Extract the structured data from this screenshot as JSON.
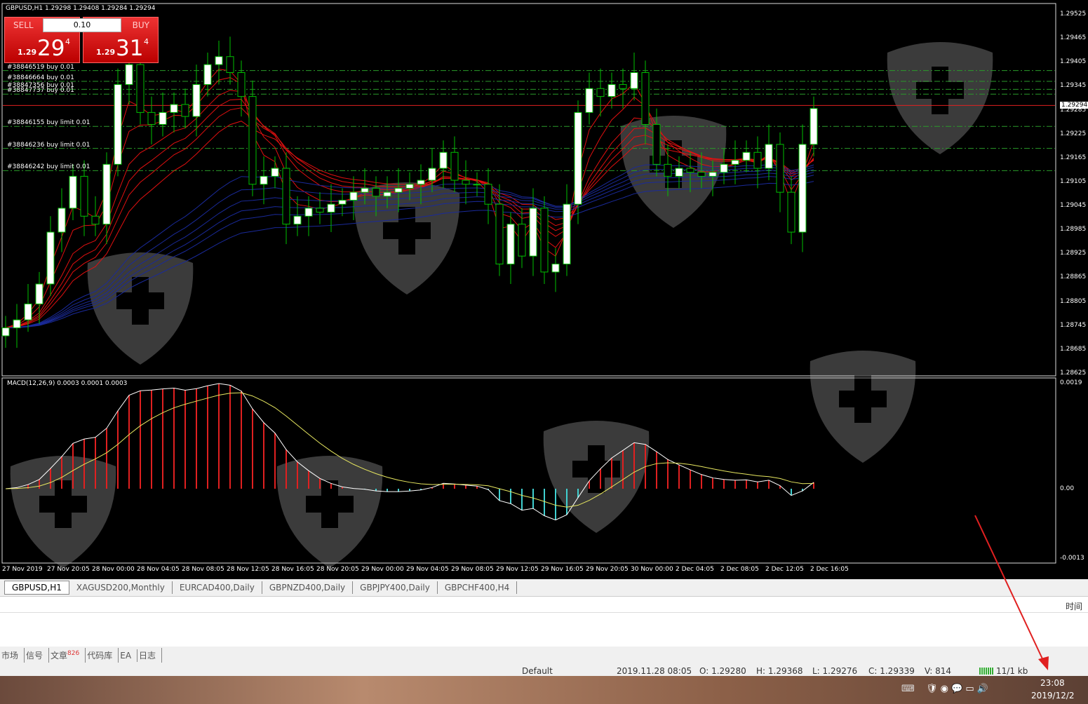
{
  "header": {
    "title": "GBPUSD,H1  1.29298 1.29408 1.29284 1.29294"
  },
  "trade": {
    "sell_label": "SELL",
    "buy_label": "BUY",
    "lot": "0.10",
    "sell_prefix": "1.29",
    "sell_big": "29",
    "sell_sup": "4",
    "buy_prefix": "1.29",
    "buy_big": "31",
    "buy_sup": "4"
  },
  "orders": [
    {
      "label": "#38846519 buy 0.01",
      "price": 1.29385
    },
    {
      "label": "#38846664 buy 0.01",
      "price": 1.29358
    },
    {
      "label": "#38847356 buy 0.01",
      "price": 1.29338
    },
    {
      "label": "#38847737 buy 0.01",
      "price": 1.29326
    },
    {
      "label": "#38846155 buy limit 0.01",
      "price": 1.29245
    },
    {
      "label": "#38846236 buy limit 0.01",
      "price": 1.2919
    },
    {
      "label": "#38846242 buy limit 0.01",
      "price": 1.29134
    }
  ],
  "price_axis": [
    "1.29525",
    "1.29465",
    "1.29405",
    "1.29345",
    "1.29285",
    "1.29225",
    "1.29165",
    "1.29105",
    "1.29045",
    "1.28985",
    "1.28925",
    "1.28865",
    "1.28805",
    "1.28745",
    "1.28685",
    "1.28625"
  ],
  "current_price": "1.29294",
  "macd": {
    "label": "MACD(12,26,9) 0.0003 0.0001 0.0003",
    "axis": [
      "0.0019",
      "0.00",
      "-0.0013"
    ]
  },
  "time_axis": [
    "27 Nov 2019",
    "27 Nov 20:05",
    "28 Nov 00:00",
    "28 Nov 04:05",
    "28 Nov 08:05",
    "28 Nov 12:05",
    "28 Nov 16:05",
    "28 Nov 20:05",
    "29 Nov 00:00",
    "29 Nov 04:05",
    "29 Nov 08:05",
    "29 Nov 12:05",
    "29 Nov 16:05",
    "29 Nov 20:05",
    "30 Nov 00:00",
    "2 Dec 04:05",
    "2 Dec 08:05",
    "2 Dec 12:05",
    "2 Dec 16:05"
  ],
  "chart_tabs": [
    "GBPUSD,H1",
    "XAGUSD200,Monthly",
    "EURCAD400,Daily",
    "GBPNZD400,Daily",
    "GBPJPY400,Daily",
    "GBPCHF400,H4"
  ],
  "terminal": {
    "time_header": "时间",
    "tabs": [
      "市场",
      "信号",
      "文章",
      "代码库",
      "EA",
      "日志"
    ],
    "article_badge": "826"
  },
  "status": {
    "profile": "Default",
    "datetime": "2019.11.28 08:05",
    "open": "O: 1.29280",
    "high": "H: 1.29368",
    "low": "L: 1.29276",
    "close": "C: 1.29339",
    "volume": "V: 814",
    "traffic": "11/1 kb"
  },
  "taskbar": {
    "time": "23:08",
    "date": "2019/12/2"
  },
  "colors": {
    "bull": "#ffffff",
    "bear": "#000000",
    "wick": "#00c000",
    "ma_fast": "#e01010",
    "ma_slow": "#1a2a9a",
    "macd_pos": "#e02020",
    "macd_neg": "#40d0d0"
  },
  "chart_data": {
    "type": "candlestick",
    "ylim": [
      1.28625,
      1.29525
    ],
    "closes": [
      1.2874,
      1.2876,
      1.288,
      1.2885,
      1.2898,
      1.2904,
      1.2912,
      1.2902,
      1.29,
      1.2915,
      1.2935,
      1.294,
      1.2928,
      1.2925,
      1.2928,
      1.293,
      1.2927,
      1.2935,
      1.294,
      1.2942,
      1.2938,
      1.2932,
      1.291,
      1.2912,
      1.2914,
      1.29,
      1.2902,
      1.2904,
      1.2903,
      1.2905,
      1.2906,
      1.2908,
      1.2909,
      1.2907,
      1.2908,
      1.2909,
      1.291,
      1.2911,
      1.2914,
      1.2918,
      1.2911,
      1.291,
      1.291,
      1.2905,
      1.289,
      1.29,
      1.2892,
      1.2904,
      1.2888,
      1.289,
      1.2905,
      1.2928,
      1.2934,
      1.2932,
      1.2935,
      1.2934,
      1.2938,
      1.2925,
      1.2915,
      1.2912,
      1.2914,
      1.2913,
      1.2912,
      1.2913,
      1.2915,
      1.2916,
      1.2918,
      1.2914,
      1.292,
      1.2908,
      1.2898,
      1.292,
      1.2929
    ]
  }
}
